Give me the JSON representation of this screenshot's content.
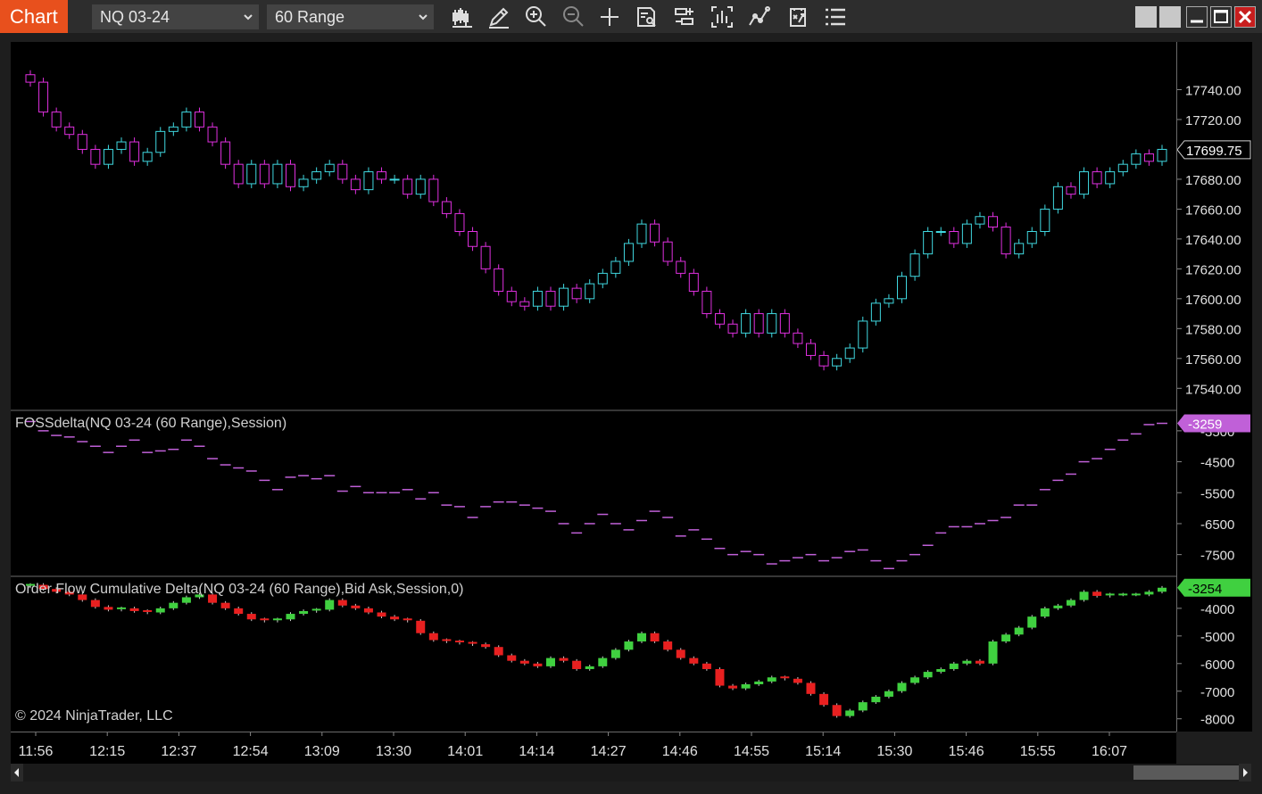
{
  "toolbar": {
    "tab_label": "Chart",
    "instrument": "NQ 03-24",
    "interval": "60 Range",
    "tools": [
      "chart-style-icon",
      "drawing-tool-icon",
      "zoom-in-icon",
      "zoom-out-icon",
      "crosshair-icon",
      "data-box-icon",
      "properties-icon",
      "bar-statistics-icon",
      "indicators-icon",
      "strategies-icon",
      "menu-icon"
    ],
    "window_buttons": [
      "window-tile-icon",
      "window-tile-icon",
      "minimize-icon",
      "maximize-icon",
      "close-icon"
    ],
    "accent": "#e8501d"
  },
  "panels": {
    "price": {
      "ticks": [
        "17740.00",
        "17720.00",
        "17700.00",
        "17680.00",
        "17660.00",
        "17640.00",
        "17620.00",
        "17600.00",
        "17580.00",
        "17560.00",
        "17540.00"
      ],
      "last_price": "17699.75",
      "colors": {
        "up": "#40d8e0",
        "down": "#e030e0"
      }
    },
    "fossdelta": {
      "label": "FOSSdelta(NQ 03-24 (60 Range),Session)",
      "ticks": [
        "-3500",
        "-4500",
        "-5500",
        "-6500",
        "-7500"
      ],
      "last_value": "-3259",
      "color": "#c060d8"
    },
    "cumdelta": {
      "label": "Order Flow Cumulative Delta(NQ 03-24 (60 Range),Bid Ask,Session,0)",
      "ticks": [
        "-4000",
        "-5000",
        "-6000",
        "-7000",
        "-8000"
      ],
      "last_value": "-3254",
      "colors": {
        "up": "#40d040",
        "down": "#e82020"
      }
    }
  },
  "time_axis": [
    "11:56",
    "12:15",
    "12:37",
    "12:54",
    "13:09",
    "13:30",
    "14:01",
    "14:14",
    "14:27",
    "14:46",
    "14:55",
    "15:14",
    "15:30",
    "15:46",
    "15:55",
    "16:07"
  ],
  "copyright": "© 2024 NinjaTrader, LLC",
  "chart_data": [
    {
      "type": "candlestick",
      "title": "NQ 03-24 60 Range",
      "ylim": [
        17530,
        17760
      ],
      "closes": [
        17745,
        17725,
        17715,
        17710,
        17700,
        17690,
        17700,
        17705,
        17692,
        17698,
        17712,
        17715,
        17725,
        17715,
        17705,
        17690,
        17677,
        17690,
        17677,
        17690,
        17675,
        17680,
        17685,
        17690,
        17680,
        17673,
        17685,
        17680,
        17680,
        17670,
        17680,
        17665,
        17657,
        17645,
        17635,
        17620,
        17605,
        17598,
        17595,
        17605,
        17595,
        17607,
        17600,
        17610,
        17617,
        17625,
        17637,
        17650,
        17638,
        17625,
        17617,
        17605,
        17590,
        17583,
        17577,
        17590,
        17577,
        17590,
        17577,
        17570,
        17562,
        17555,
        17560,
        17567,
        17585,
        17597,
        17600,
        17615,
        17630,
        17645,
        17645,
        17637,
        17650,
        17655,
        17648,
        17630,
        17637,
        17645,
        17660,
        17675,
        17670,
        17685,
        17677,
        17685,
        17690,
        17697,
        17692,
        17700
      ]
    },
    {
      "type": "line",
      "title": "FOSSdelta(NQ 03-24 (60 Range),Session)",
      "ylim": [
        -8000,
        -3100
      ],
      "values": [
        -3200,
        -3500,
        -3650,
        -3700,
        -3850,
        -4000,
        -4200,
        -4000,
        -3800,
        -4200,
        -4150,
        -4100,
        -3800,
        -4000,
        -4400,
        -4600,
        -4700,
        -4800,
        -5100,
        -5400,
        -5000,
        -4950,
        -5050,
        -4950,
        -5450,
        -5300,
        -5500,
        -5500,
        -5500,
        -5400,
        -5700,
        -5500,
        -5900,
        -5950,
        -6300,
        -5950,
        -5800,
        -5800,
        -5900,
        -6000,
        -6100,
        -6500,
        -6800,
        -6500,
        -6200,
        -6500,
        -6700,
        -6400,
        -6100,
        -6300,
        -6900,
        -6700,
        -7000,
        -7300,
        -7500,
        -7400,
        -7500,
        -7800,
        -7700,
        -7600,
        -7500,
        -7700,
        -7600,
        -7400,
        -7350,
        -7700,
        -7950,
        -7700,
        -7500,
        -7200,
        -6800,
        -6600,
        -6600,
        -6500,
        -6400,
        -6300,
        -5900,
        -5900,
        -5400,
        -5100,
        -4900,
        -4500,
        -4400,
        -4100,
        -3800,
        -3600,
        -3300,
        -3259
      ]
    },
    {
      "type": "candlestick",
      "title": "Order Flow Cumulative Delta(NQ 03-24 (60 Range),Bid Ask,Session,0)",
      "ylim": [
        -8300,
        -3100
      ],
      "closes": [
        -3150,
        -3300,
        -3400,
        -3500,
        -3700,
        -3950,
        -4050,
        -4000,
        -4100,
        -4150,
        -4000,
        -3800,
        -3600,
        -3500,
        -3800,
        -4000,
        -4200,
        -4400,
        -4450,
        -4400,
        -4200,
        -4100,
        -4050,
        -3700,
        -3900,
        -4000,
        -4150,
        -4300,
        -4400,
        -4450,
        -4900,
        -5150,
        -5200,
        -5250,
        -5300,
        -5400,
        -5700,
        -5900,
        -6000,
        -6100,
        -5800,
        -5900,
        -6200,
        -6100,
        -5800,
        -5500,
        -5200,
        -4900,
        -5200,
        -5500,
        -5800,
        -6000,
        -6200,
        -6800,
        -6900,
        -6750,
        -6650,
        -6500,
        -6550,
        -6700,
        -7100,
        -7500,
        -7900,
        -7700,
        -7400,
        -7200,
        -7000,
        -6700,
        -6500,
        -6300,
        -6200,
        -6000,
        -5900,
        -6000,
        -5200,
        -4950,
        -4700,
        -4300,
        -4000,
        -3900,
        -3700,
        -3400,
        -3550,
        -3500,
        -3500,
        -3500,
        -3400,
        -3254
      ]
    }
  ]
}
